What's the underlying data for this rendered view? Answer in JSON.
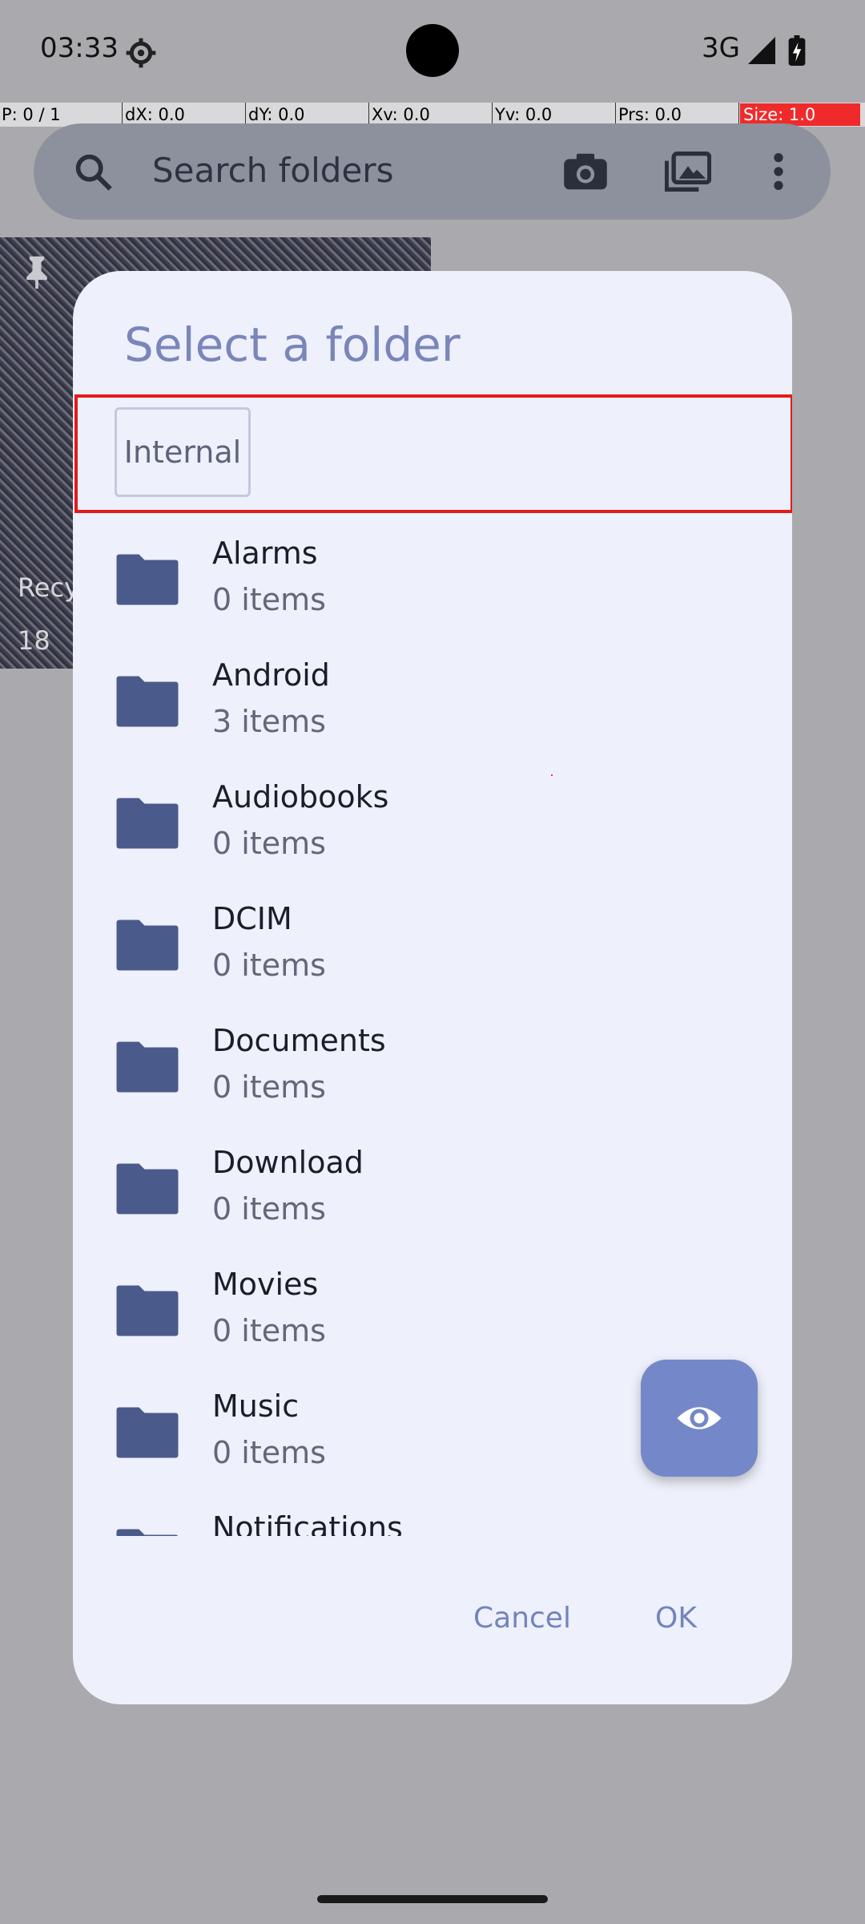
{
  "status": {
    "time": "03:33",
    "network": "3G"
  },
  "debug": {
    "p": "P: 0 / 1",
    "dx": "dX: 0.0",
    "dy": "dY: 0.0",
    "xv": "Xv: 0.0",
    "yv": "Yv: 0.0",
    "prs": "Prs: 0.0",
    "size": "Size: 1.0"
  },
  "search": {
    "placeholder": "Search folders"
  },
  "background_folder": {
    "label": "Recy",
    "count": "18"
  },
  "dialog": {
    "title": "Select a folder",
    "breadcrumb": "Internal",
    "folders": [
      {
        "name": "Alarms",
        "count": "0 items"
      },
      {
        "name": "Android",
        "count": "3 items"
      },
      {
        "name": "Audiobooks",
        "count": "0 items"
      },
      {
        "name": "DCIM",
        "count": "0 items"
      },
      {
        "name": "Documents",
        "count": "0 items"
      },
      {
        "name": "Download",
        "count": "0 items"
      },
      {
        "name": "Movies",
        "count": "0 items"
      },
      {
        "name": "Music",
        "count": "0 items"
      },
      {
        "name": "Notifications",
        "count": ""
      }
    ],
    "cancel_label": "Cancel",
    "ok_label": "OK"
  },
  "colors": {
    "folder_icon": "#4a5a8a",
    "accent": "#7384bd",
    "dialog_bg": "#eef0fb",
    "highlight_border": "#e31b1b"
  },
  "icons": {
    "fab": "eye-icon",
    "folder": "folder-icon"
  }
}
